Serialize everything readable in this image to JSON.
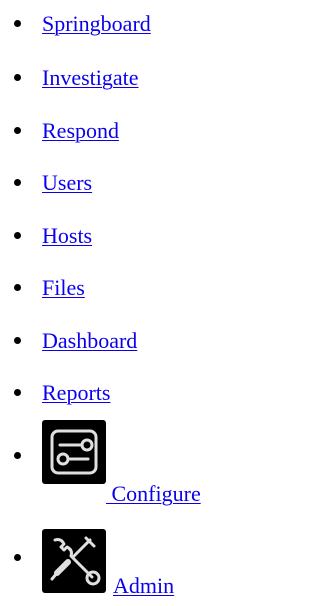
{
  "nav": {
    "items": [
      {
        "label": "Springboard"
      },
      {
        "label": "Investigate"
      },
      {
        "label": "Respond"
      },
      {
        "label": "Users"
      },
      {
        "label": "Hosts"
      },
      {
        "label": "Files"
      },
      {
        "label": "Dashboard"
      },
      {
        "label": "Reports"
      },
      {
        "label": " Configure",
        "icon": "sliders-icon"
      },
      {
        "label": "Admin",
        "icon": "tools-icon"
      }
    ]
  },
  "colors": {
    "link": "#0b00ee",
    "bullet": "#000000",
    "icon_tile_bg": "#000000",
    "icon_stroke": "#e0e0e0"
  }
}
